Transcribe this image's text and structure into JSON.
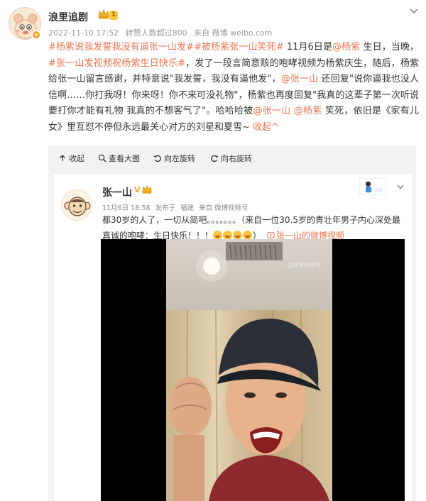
{
  "post": {
    "author": "浪里追剧",
    "level": "1",
    "meta": {
      "time": "2022-11-10 17:52",
      "reposts": "转赞人数超过800",
      "source": "来自 微博 weibo.com"
    },
    "content": [
      {
        "t": "tag",
        "v": "#杨紫说我发誓我没有逼张一山发#"
      },
      {
        "t": "tag",
        "v": "#被杨紫张一山笑死#"
      },
      {
        "t": "text",
        "v": " 11月6日是"
      },
      {
        "t": "at",
        "v": "@杨紫"
      },
      {
        "t": "text",
        "v": " 生日，当晚，"
      },
      {
        "t": "tag",
        "v": "#张一山发视频祝杨紫生日快乐#"
      },
      {
        "t": "text",
        "v": "，发了一段言简意赅的咆哮视频为杨紫庆生，随后，杨紫给张一山留言感谢，并特意说\"我发誓，我没有逼他发\"，"
      },
      {
        "t": "at",
        "v": "@张一山"
      },
      {
        "t": "text",
        "v": " 还回复\"说你逼我也没人信啊……你打我呀！你来呀！你不来可没礼物\"，杨紫也再度回复\"我真的这辈子第一次听说 要打你才能有礼物 我真的不想客气了\"。哈哈哈被"
      },
      {
        "t": "at",
        "v": "@张一山"
      },
      {
        "t": "text",
        "v": " "
      },
      {
        "t": "at",
        "v": "@杨紫"
      },
      {
        "t": "text",
        "v": " 笑死，依旧是《家有儿女》里互怼不停但永远最关心对方的刘星和夏雪~ "
      },
      {
        "t": "link",
        "v": "收起^"
      }
    ]
  },
  "toolbar": {
    "collapse": "收起",
    "view_large": "查看大图",
    "rotate_left": "向左旋转",
    "rotate_right": "向右旋转"
  },
  "repost": {
    "author": "张一山",
    "vip_mark": "V",
    "meta": {
      "time": "11月6日 18:58",
      "publish_prefix": "发布于",
      "location": "福建",
      "source": "来自 微博视频号"
    },
    "text_before": "都30岁的人了，一切从简吧。。。。。。。（来自一位30.5岁的青壮年男子内心深处最真诚的咆哮：生日快乐！！！",
    "emoji_count": 4,
    "text_after": "）",
    "video_link": "张一山的微博视频",
    "video_watermark": "@微博视频号"
  },
  "colors": {
    "accent": "#eb7350",
    "meta_gray": "#999999",
    "repost_bg": "#f2f2f5",
    "vip_gold": "#f5a623"
  }
}
